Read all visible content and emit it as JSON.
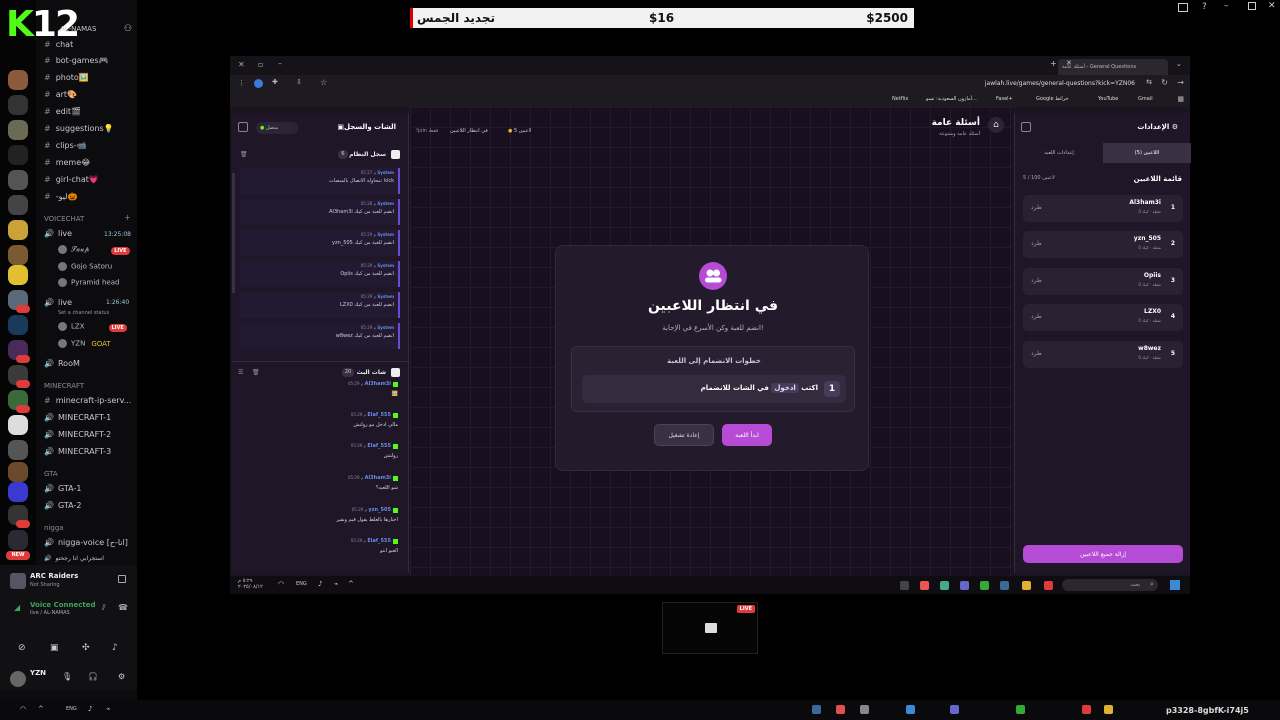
{
  "overlay": {
    "item": "تجديد الجمس",
    "price": "$16",
    "goal": "$2500"
  },
  "kick_logo": {
    "k": "K",
    "num": "12"
  },
  "discord": {
    "server_name": "AL-NAMAS",
    "channels": [
      "chat",
      "bot-games🎮",
      "photo🖼️",
      "art🎨",
      "edit🎬",
      "suggestions💡",
      "clips-📹",
      "meme😂",
      "girl-chat💗",
      "-ليو🎃"
    ],
    "voicechat_cat": "VOICECHAT",
    "live1": {
      "name": "live",
      "time": "13:25:08",
      "users": [
        "𝒮𝒶𝓊𝓅",
        "Gojo Satoru",
        "Pyramid head"
      ]
    },
    "live2": {
      "name": "live",
      "time": "1:26:40",
      "status": "Set a channel status",
      "users": [
        "LZX",
        "YZN"
      ],
      "goat": "GOAT"
    },
    "room": "RooM",
    "minecraft_cat": "MINECRAFT",
    "minecraft": [
      "minecraft-ip-serv...",
      "MINECRAFT-1",
      "MINECRAFT-2",
      "MINECRAFT-3"
    ],
    "gta_cat": "GTA",
    "gta": [
      "GTA-1",
      "GTA-2"
    ],
    "nigga_cat": "nigga",
    "nigga": [
      "nigga-voice [انا-ح]",
      "استجرابي انا رجحتو"
    ],
    "live_badge": "LIVE",
    "new_badge": "NEW",
    "activity": {
      "title": "ARC Raiders",
      "sub": "Not Sharing"
    },
    "voice": {
      "status": "Voice Connected",
      "channel": "live / AL-NAMAS"
    },
    "user": "YZN"
  },
  "browser": {
    "tab_title": "أسئلة عامة - General Questions",
    "url": "jawlah.live/games/general-questions?kick=YZN06",
    "bookmarks": [
      "Netflix",
      "أمازون السعودية: تسو...",
      "Fasel+",
      "Google خرائط",
      "YouTube",
      "Gmail"
    ]
  },
  "game": {
    "title": "أسئلة عامة",
    "subtitle": "أسئلة عامة ومتنوعة",
    "players_count": "5 لاعبين",
    "waiting_badge": "في انتظار اللاعبين",
    "join_only": "!join فقط",
    "card_title": "في انتظار اللاعبين",
    "card_sub": "انضم للعبة وكن الأسرع في الإجابة!",
    "steps_title": "خطوات الانضمام إلى اللعبة",
    "step_num": "1",
    "step_pre": "اكتب",
    "step_code": "ادخول",
    "step_post": "في الشات للانضمام",
    "btn_start": "ابدأ اللعبة",
    "btn_replay": "إعادة تشغيل"
  },
  "chat": {
    "title": "الشات والسجل",
    "connected": "متصل",
    "log_title": "سجل النظام",
    "log_count": "6",
    "system": "System",
    "log": [
      {
        "time": "05:27 م",
        "text": "محاولة الاتصال بالمنصات: kick"
      },
      {
        "time": "05:28 م",
        "text": "Al3ham3i انضم للعبة من كيك"
      },
      {
        "time": "05:29 م",
        "text": "yzn_505 انضم للعبة من كيك"
      },
      {
        "time": "05:29 م",
        "text": "Opiis انضم للعبة من كيك"
      },
      {
        "time": "05:29 م",
        "text": "LZX0 انضم للعبة من كيك"
      },
      {
        "time": "05:29 م",
        "text": "w8wez انضم للعبة من كيك"
      }
    ],
    "live_title": "شات البث",
    "live_count": "20",
    "messages": [
      {
        "time": "05:29 م",
        "user": "Al3ham3i",
        "text": "🖼️"
      },
      {
        "time": "05:29 م",
        "user": "Elaf_555",
        "text": "مالي ادخل مو رولتش"
      },
      {
        "time": "05:29 م",
        "user": "Elaf_555",
        "text": "رولتش"
      },
      {
        "time": "05:29 م",
        "user": "Al3ham3i",
        "text": "شو اللعبه؟"
      },
      {
        "time": "05:29 م",
        "user": "yzn_505",
        "text": "اختارها بالغلط يقول قيم ونفير"
      },
      {
        "time": "05:29 م",
        "user": "Elaf_555",
        "text": "العبو انتو"
      }
    ]
  },
  "settings": {
    "title": "الإعدادات",
    "tab_players": "اللاعبين (5)",
    "tab_game": "إعدادات اللعبة",
    "list_title": "قائمة اللاعبين",
    "list_count": "5 / 100 لاعبين",
    "kick_label": "طرد",
    "score_label": "0 نقطة · كيك",
    "players": [
      {
        "rank": "1",
        "name": "Al3ham3i"
      },
      {
        "rank": "2",
        "name": "yzn_505"
      },
      {
        "rank": "3",
        "name": "Opiis"
      },
      {
        "rank": "4",
        "name": "LZX0"
      },
      {
        "rank": "5",
        "name": "w8wez"
      }
    ],
    "remove_all": "إزالة جميع اللاعبين"
  },
  "win_taskbar": {
    "search": "بحث",
    "lang": "ENG",
    "date": "٢٠٢٥/٠٨/١٢",
    "time": "٥:٢٩ م"
  },
  "stream_taskbar": {
    "lang": "ENG",
    "code": "p3328-8gbfK-i74j5"
  },
  "preview_badge": "LIVE"
}
